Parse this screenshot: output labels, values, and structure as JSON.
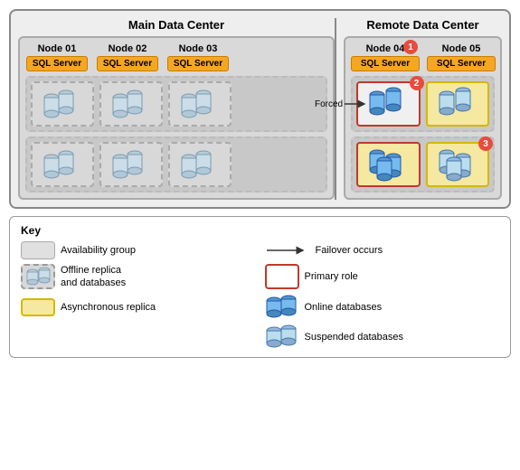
{
  "diagram": {
    "main_dc_label": "Main Data Center",
    "remote_dc_label": "Remote Data Center",
    "nodes": {
      "main": [
        "Node 01",
        "Node 02",
        "Node 03"
      ],
      "remote": [
        "Node 04",
        "Node 05"
      ]
    },
    "sql_label": "SQL Server",
    "forced_label": "Forced",
    "badges": {
      "node04": "1",
      "top_right_remote": "2",
      "bottom_right_remote": "3"
    }
  },
  "legend": {
    "title": "Key",
    "items": [
      {
        "label": "Availability group",
        "type": "gray"
      },
      {
        "label": "Failover occurs",
        "type": "arrow"
      },
      {
        "label": "Offline replica\nand databases",
        "type": "dashed"
      },
      {
        "label": "Primary role",
        "type": "primary"
      },
      {
        "label": "Asynchronous replica",
        "type": "yellow"
      },
      {
        "label": "Online databases",
        "type": "online-db"
      },
      {
        "label": "",
        "type": "empty"
      },
      {
        "label": "Suspended databases",
        "type": "suspended-db"
      }
    ]
  }
}
